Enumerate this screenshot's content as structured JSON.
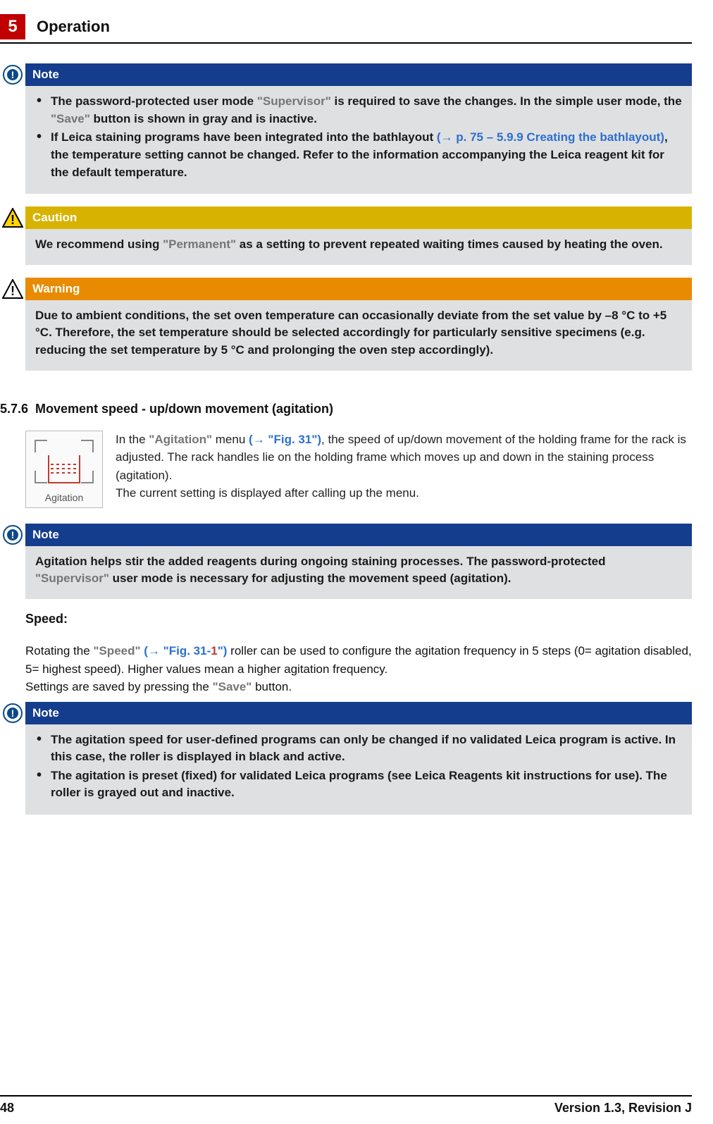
{
  "header": {
    "chapter_number": "5",
    "chapter_title": "Operation"
  },
  "note1": {
    "title": "Note",
    "b1_pre": "The password-protected user mode ",
    "b1_term1": "\"Supervisor\"",
    "b1_mid": " is required to save the changes. In the simple user mode, the ",
    "b1_term2": "\"Save\"",
    "b1_post": " button is shown in gray and is inactive.",
    "b2_pre": "If Leica staining programs have been integrated into the bathlayout ",
    "b2_link": "(→ p. 75 – 5.9.9 Creating the bathlayout)",
    "b2_post": ", the temperature setting cannot be changed. Refer to the information accompanying the Leica reagent kit for the default temperature."
  },
  "caution": {
    "title": "Caution",
    "pre": "We recommend using ",
    "term": "\"Permanent\"",
    "post": " as a setting to prevent repeated waiting times caused by heating the oven."
  },
  "warning": {
    "title": "Warning",
    "text": "Due to ambient conditions, the set oven temperature can occasionally deviate from the set value by –8 °C to +5 °C. Therefore, the set temperature should be selected accordingly for particularly sensitive specimens (e.g. reducing the set temperature by 5 °C and prolonging the oven step accordingly)."
  },
  "section": {
    "number": "5.7.6",
    "title": "Movement speed - up/down movement (agitation)"
  },
  "agitation_tile_label": "Agitation",
  "intro": {
    "pre": "In the ",
    "term": "\"Agitation\"",
    "mid": " menu ",
    "link": "(→ \"Fig. 31\")",
    "post": ", the speed of up/down movement of the holding frame for the rack is adjusted. The rack handles lie on the holding frame which moves up and down in the staining process (agitation).",
    "line2": "The current setting is displayed after calling up the menu."
  },
  "note2": {
    "title": "Note",
    "pre": "Agitation helps stir the added reagents during ongoing staining processes. The password-protected ",
    "term": "\"Supervisor\"",
    "post": " user mode is necessary for adjusting the movement speed (agitation)."
  },
  "speed_heading": "Speed:",
  "speed_para": {
    "p1_pre": "Rotating the ",
    "p1_term": "\"Speed\"",
    "p1_sp": " ",
    "p1_link_open": "(→ ",
    "p1_link_fig": "\"Fig. 31-",
    "p1_link_num": "1",
    "p1_link_close": "\")",
    "p1_post": " roller can be used to configure the agitation frequency in 5 steps (0= agitation disabled, 5= highest speed). Higher values mean a higher agitation frequency.",
    "p2_pre": "Settings are saved by pressing the ",
    "p2_term": "\"Save\"",
    "p2_post": " button."
  },
  "note3": {
    "title": "Note",
    "b1": "The agitation speed for user-defined programs can only be changed if no validated Leica program is active. In this case, the roller is displayed in black and active.",
    "b2": "The agitation is preset (fixed) for validated Leica programs (see Leica Reagents kit instructions for use). The roller is grayed out and inactive."
  },
  "footer": {
    "page": "48",
    "version": "Version 1.3, Revision J"
  }
}
